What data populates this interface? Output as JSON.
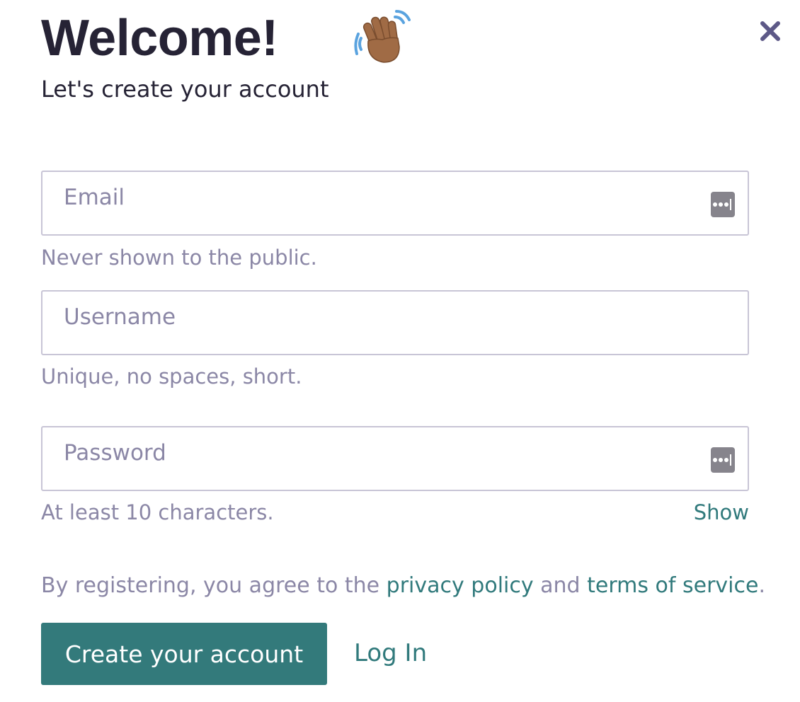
{
  "header": {
    "title": "Welcome!",
    "subtitle": "Let's create your account",
    "wave_icon": "waving-hand-icon",
    "close_icon": "close-icon"
  },
  "form": {
    "email": {
      "placeholder": "Email",
      "value": "",
      "hint": "Never shown to the public.",
      "autofill_icon": "password-manager-icon"
    },
    "username": {
      "placeholder": "Username",
      "value": "",
      "hint": "Unique, no spaces, short."
    },
    "password": {
      "placeholder": "Password",
      "value": "",
      "hint": "At least 10 characters.",
      "autofill_icon": "password-manager-icon",
      "show_label": "Show"
    }
  },
  "legal": {
    "prefix": "By registering, you agree to the ",
    "privacy_label": "privacy policy",
    "conjunction": " and ",
    "terms_label": "terms of service",
    "suffix": "."
  },
  "actions": {
    "create_label": "Create your account",
    "login_label": "Log In"
  },
  "colors": {
    "heading": "#262335",
    "muted": "#8b87a6",
    "accent": "#317a7c",
    "button": "#337a7b",
    "border": "#c8c5d6",
    "close_icon": "#5d5987"
  }
}
